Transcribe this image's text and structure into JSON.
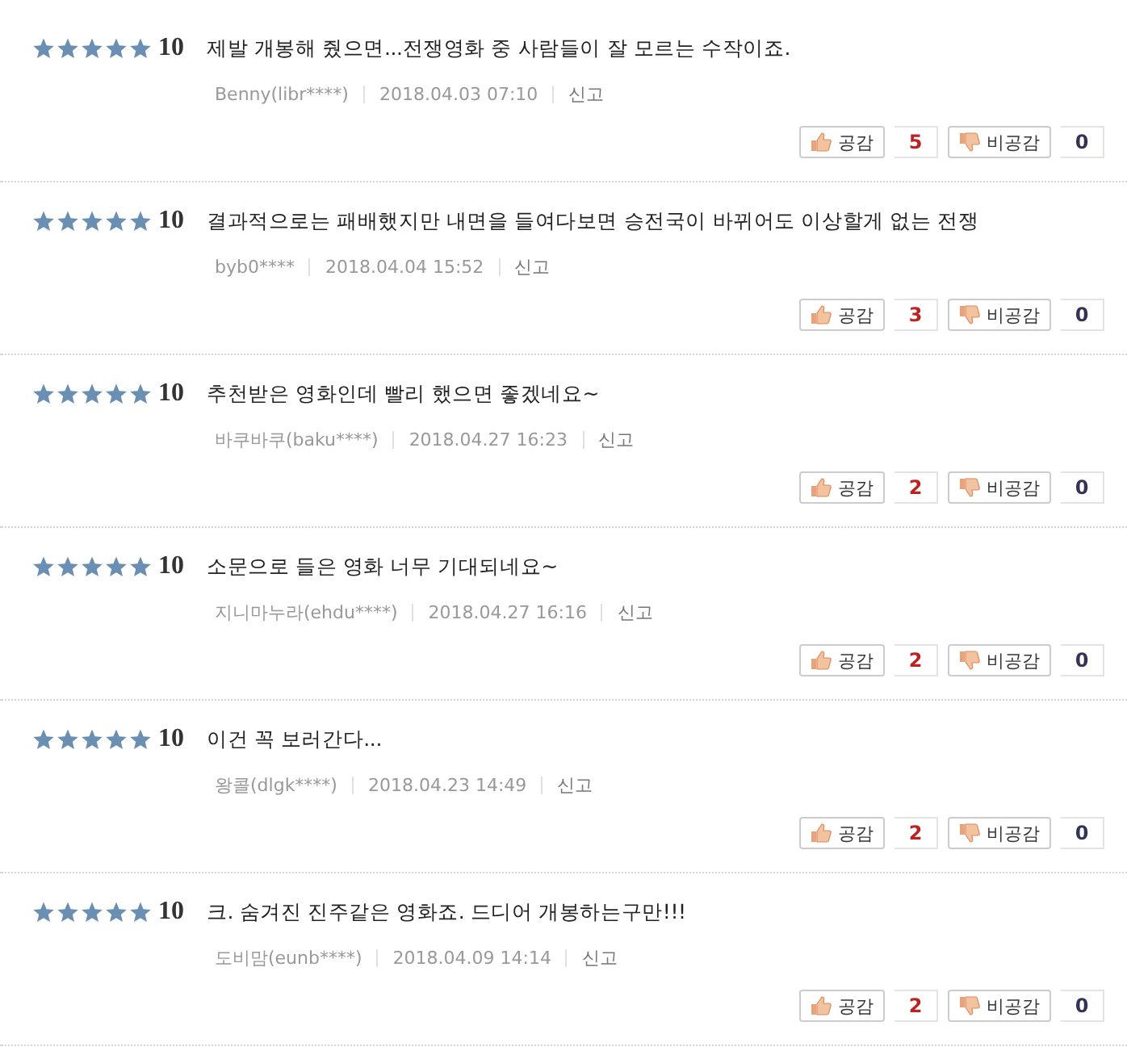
{
  "reviews": [
    {
      "stars": 5,
      "score": "10",
      "text": "제발 개봉해 줬으면...전쟁영화 중 사람들이 잘 모르는 수작이죠.",
      "author": "Benny(libr****)",
      "date": "2018.04.03 07:10",
      "report": "신고",
      "like_label": "공감",
      "likes": "5",
      "dislike_label": "비공감",
      "dislikes": "0"
    },
    {
      "stars": 5,
      "score": "10",
      "text": "결과적으로는 패배했지만 내면을 들여다보면 승전국이 바뀌어도 이상할게 없는 전쟁",
      "author": "byb0****",
      "date": "2018.04.04 15:52",
      "report": "신고",
      "like_label": "공감",
      "likes": "3",
      "dislike_label": "비공감",
      "dislikes": "0"
    },
    {
      "stars": 5,
      "score": "10",
      "text": "추천받은 영화인데 빨리 했으면 좋겠네요~",
      "author": "바쿠바쿠(baku****)",
      "date": "2018.04.27 16:23",
      "report": "신고",
      "like_label": "공감",
      "likes": "2",
      "dislike_label": "비공감",
      "dislikes": "0"
    },
    {
      "stars": 5,
      "score": "10",
      "text": "소문으로 들은 영화 너무 기대되네요~",
      "author": "지니마누라(ehdu****)",
      "date": "2018.04.27 16:16",
      "report": "신고",
      "like_label": "공감",
      "likes": "2",
      "dislike_label": "비공감",
      "dislikes": "0"
    },
    {
      "stars": 5,
      "score": "10",
      "text": "이건 꼭 보러간다...",
      "author": "왕콜(dlgk****)",
      "date": "2018.04.23 14:49",
      "report": "신고",
      "like_label": "공감",
      "likes": "2",
      "dislike_label": "비공감",
      "dislikes": "0"
    },
    {
      "stars": 5,
      "score": "10",
      "text": "크. 숨겨진 진주같은 영화죠. 드디어 개봉하는구만!!!",
      "author": "도비맘(eunb****)",
      "date": "2018.04.09 14:14",
      "report": "신고",
      "like_label": "공감",
      "likes": "2",
      "dislike_label": "비공감",
      "dislikes": "0"
    }
  ]
}
